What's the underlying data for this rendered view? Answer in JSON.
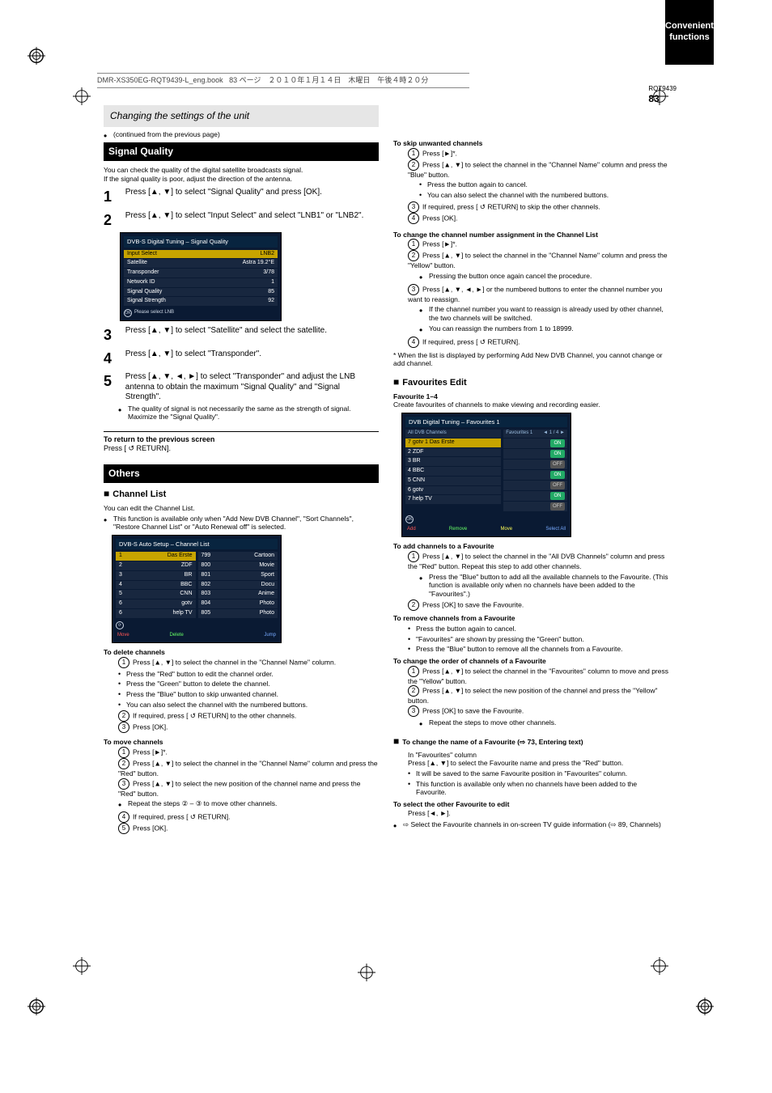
{
  "header": {
    "filename": "DMR-XS350EG-RQT9439-L_eng.book",
    "page_info": "83 ページ　２０１０年１月１４日　木曜日　午後４時２０分"
  },
  "grey_band_1": "Changing the settings of the unit",
  "continued_bullet": "(continued from the previous page)",
  "section_signal_quality": {
    "heading": "Signal Quality",
    "intro": "You can check the quality of the digital satellite broadcasts signal.",
    "line2": "If the signal quality is poor, adjust the direction of the antenna.",
    "steps": [
      {
        "num": "1",
        "body_prefix": "Press [",
        "body_arrows": "▲, ▼",
        "body_suffix": "] to select \"Signal Quality\" and press [OK]."
      },
      {
        "num": "2",
        "body_prefix": "Press [",
        "body_arrows": "▲, ▼",
        "body_suffix": "] to select \"Input Select\" and select \"LNB1\" or \"LNB2\"."
      }
    ],
    "screen": {
      "title": "DVB-S Digital Tuning – Signal Quality",
      "rows": [
        {
          "left": "Input Select",
          "right": "LNB2",
          "sel": true
        },
        {
          "left": "Satellite",
          "right": "Astra 19.2°E",
          "sel": false
        },
        {
          "left": "Transponder",
          "right": "3/78",
          "sel": false
        },
        {
          "left": "Network ID",
          "right": "1",
          "sel": false
        },
        {
          "left": "Signal Quality",
          "right": "85",
          "sel": false
        },
        {
          "left": "Signal Strength",
          "right": "92",
          "sel": false
        }
      ],
      "hint": "Please select LNB"
    },
    "post_steps": [
      {
        "num": "3",
        "body_prefix": "Press [",
        "body_arrows": "▲, ▼",
        "body_suffix": "] to select \"Satellite\" and select the satellite."
      },
      {
        "num": "4",
        "body_prefix": "Press [",
        "body_arrows": "▲, ▼",
        "body_suffix": "] to select \"Transponder\"."
      },
      {
        "num": "5",
        "body_prefix": "Press [",
        "body_arrows": "▲, ▼, ◄, ►",
        "body_suffix": "] to select \"Transponder\" and adjust the LNB antenna to obtain the maximum \"Signal Quality\" and \"Signal Strength\"."
      }
    ],
    "post_bullet": "The quality of signal is not necessarily the same as the strength of signal. Maximize the \"Signal Quality\".",
    "to_return": "To return to the previous screen",
    "to_return_action": "Press [ ↺ RETURN]."
  },
  "section_others": {
    "heading": "Others",
    "subhead": "Channel List",
    "intro": "You can edit the Channel List.",
    "bullet": "This function is available only when \"Add New DVB Channel\", \"Sort Channels\", \"Restore Channel List\" or \"Auto Renewal off\" is selected.",
    "screen": {
      "title": "DVB-S Auto Setup – Channel List",
      "cols": [
        [
          {
            "no": "1",
            "name": "Das Erste"
          },
          {
            "no": "2",
            "name": "ZDF"
          },
          {
            "no": "3",
            "name": "BR"
          },
          {
            "no": "4",
            "name": "BBC"
          },
          {
            "no": "5",
            "name": "CNN"
          },
          {
            "no": "6",
            "name": "gotv"
          },
          {
            "no": "6",
            "name": "help TV"
          }
        ],
        [
          {
            "no": "799",
            "name": "Cartoon"
          },
          {
            "no": "800",
            "name": "Movie"
          },
          {
            "no": "801",
            "name": "Sport"
          },
          {
            "no": "802",
            "name": "Docu"
          },
          {
            "no": "803",
            "name": "Anime"
          },
          {
            "no": "804",
            "name": "Photo"
          },
          {
            "no": "805",
            "name": "Photo"
          }
        ]
      ],
      "btnbar": {
        "r": "Move",
        "g": "Delete",
        "y": "",
        "b": "Jump"
      }
    },
    "todelete": "To delete channels",
    "todelete_steps": [
      {
        "num": "1",
        "body_prefix": "Press [",
        "body_arrows": "▲, ▼",
        "body_suffix": "] to select the channel in the \"Channel Name\" column."
      }
    ],
    "todelete_bullets": [
      "Press the \"Red\" button to edit the channel order.",
      "Press the \"Green\" button to delete the channel.",
      "Press the \"Blue\" button to skip unwanted channel.",
      "You can also select the channel with the numbered buttons."
    ],
    "todelete_tail": [
      {
        "num": "2",
        "body": "If required, press [ ↺ RETURN] to the other channels."
      },
      {
        "num": "3",
        "body": "Press [OK]."
      }
    ],
    "tomove": "To move channels",
    "tomove_steps": [
      {
        "num": "1",
        "body": "Press [►]*."
      },
      {
        "num": "2",
        "body_prefix": "Press [",
        "body_arrows": "▲, ▼",
        "body_suffix": "] to select the channel in the \"Channel Name\" column and press the \"Red\" button."
      },
      {
        "num": "3",
        "body_prefix": "Press [",
        "body_arrows": "▲, ▼",
        "body_suffix": "] to select the new position of the channel name and press the \"Red\" button."
      },
      {
        "b": true,
        "body": "Repeat the steps ② – ③ to move other channels."
      },
      {
        "num": "4",
        "body": "If required, press [ ↺ RETURN]."
      },
      {
        "num": "5",
        "body": "Press [OK]."
      }
    ]
  },
  "right_col": {
    "toskip": "To skip unwanted channels",
    "toskip_steps": [
      {
        "num": "1",
        "body": "Press [►]*."
      },
      {
        "num": "2",
        "body_prefix": "Press [",
        "body_arrows": "▲, ▼",
        "body_suffix": "] to select the channel in the \"Channel Name\" column and press the \"Blue\" button."
      }
    ],
    "toskip_bullets": [
      "Press the button again to cancel.",
      "You can also select the channel with the numbered buttons."
    ],
    "toskip_tail": [
      {
        "num": "3",
        "body": "If required, press [ ↺ RETURN] to skip the other channels."
      },
      {
        "num": "4",
        "body": "Press [OK]."
      }
    ],
    "tochange_head": "To change the channel number assignment in the Channel List",
    "tochange_steps": [
      {
        "num": "1",
        "body": "Press [►]*."
      },
      {
        "num": "2",
        "body_prefix": "Press [",
        "body_arrows": "▲, ▼",
        "body_suffix": "] to select the channel in the \"Channel Name\" column and press the \"Yellow\" button."
      },
      {
        "b": true,
        "body": "Pressing the button once again cancel the procedure."
      },
      {
        "num": "3",
        "body_prefix": "Press [",
        "body_arrows": "▲, ▼, ◄, ►",
        "body_suffix": "] or the numbered buttons to enter the channel number you want to reassign."
      },
      {
        "b": true,
        "body": "If the channel number you want to reassign is already used by other channel, the two channels will be switched."
      },
      {
        "b": true,
        "body": "You can reassign the numbers from 1 to 18999."
      },
      {
        "num": "4",
        "body": "If required, press [ ↺ RETURN]."
      }
    ],
    "star_note": "* When the list is displayed by performing Add New DVB Channel, you cannot change or add channel.",
    "favedit_head": "Favourites Edit",
    "favedit_body": "Favourite 1–4",
    "favedit_note": "Create favourites of channels to make viewing and recording easier.",
    "screen": {
      "title": "DVB Digital Tuning – Favourites 1",
      "left_col": [
        "All DVB Channels",
        "7 gotv 1 Das Erste",
        "2 ZDF",
        "3 BR",
        "4 BBC",
        "5 CNN",
        "6 gotv",
        "7 help TV"
      ],
      "right_col_label": "Favourites 1",
      "btnbar": {
        "r": "Add",
        "g": "Remove",
        "y": "Move",
        "b": "Select All"
      },
      "pager": "◄ 1 / 4 ►"
    },
    "toadd": "To add channels to a Favourite",
    "toadd_steps": [
      {
        "num": "1",
        "body_prefix": "Press [",
        "body_arrows": "▲, ▼",
        "body_suffix": "] to select the channel in the \"All DVB Channels\" column and press the \"Red\" button. Repeat this step to add other channels."
      },
      {
        "b": true,
        "body": "Press the \"Blue\" button to add all the available channels to the Favourite. (This function is available only when no channels have been added to the \"Favourites\".)"
      },
      {
        "num": "2",
        "body": "Press [OK] to save the Favourite."
      }
    ],
    "toremove": "To remove channels from a Favourite",
    "toremove_bullets": [
      "Press the button again to cancel.",
      "\"Favourites\" are shown by pressing the \"Green\" button.",
      "Press the \"Blue\" button to remove all the channels from a Favourite."
    ],
    "tochangeorder": "To change the order of channels of a Favourite",
    "tochangeorder_steps": [
      {
        "num": "1",
        "body_prefix": "Press [",
        "body_arrows": "▲, ▼",
        "body_suffix": "] to select the channel in the \"Favourites\" column to move and press the \"Yellow\" button."
      },
      {
        "num": "2",
        "body_prefix": "Press [",
        "body_arrows": "▲, ▼",
        "body_suffix": "] to select the new position of the channel and press the \"Yellow\" button."
      },
      {
        "num": "3",
        "body": "Press [OK] to save the Favourite."
      },
      {
        "b": true,
        "body": "Repeat the steps to move other channels."
      }
    ],
    "tochangename_head": "To change the name of a Favourite (⇨ 73, Entering text)",
    "tochangename_note": "In \"Favourites\" column",
    "tochangename_body_prefix": "Press [",
    "tochangename_arrows": "▲, ▼",
    "tochangename_body_suffix": "] to select the Favourite name and press the \"Red\" button.",
    "tochangename_bullets": [
      "It will be saved to the same Favourite position in \"Favourites\" column.",
      "This function is available only when no channels have been added to the Favourite."
    ],
    "toselectother": "To select the other Favourite to edit",
    "toselectother_body_prefix": "Press [",
    "toselectother_arrows": "◄, ►",
    "toselectother_body_suffix": "].",
    "tail_bullet": "Select the Favourite channels in on-screen TV guide information (⇨ 89, Channels)"
  },
  "side_tab": "Convenient functions",
  "page_number": {
    "code": "RQT9439",
    "num": "83"
  }
}
